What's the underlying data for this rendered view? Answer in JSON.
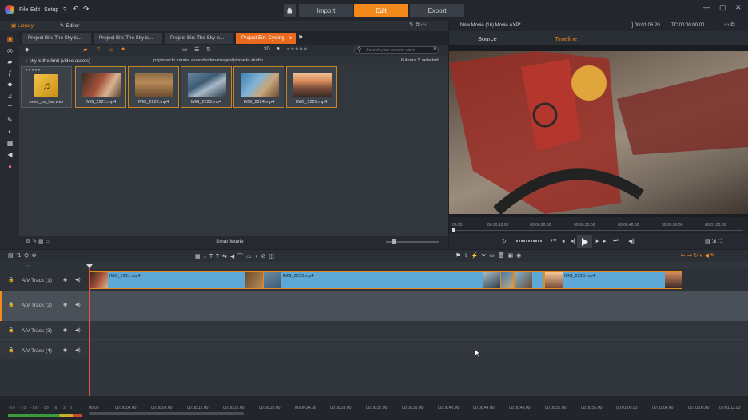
{
  "menu": {
    "file": "File",
    "edit": "Edit",
    "setup": "Setup",
    "help": "?",
    "undo": "↶",
    "redo": "↷"
  },
  "modes": {
    "import": "Import",
    "edit": "Edit",
    "export": "Export"
  },
  "library": {
    "library_tab": "Library",
    "editor_tab": "Editor"
  },
  "bin_tabs": [
    "Project Bin: The Sky is...",
    "Project Bin: The Sky is...",
    "Project Bin: The Sky is...",
    "Project Bin: Cycling"
  ],
  "bin_close": "×",
  "toolbar": {
    "threed": "3D",
    "stars": "★★★★★",
    "search_placeholder": "Search your current view"
  },
  "path": {
    "folder": "sky is the limit (video assets)",
    "location": "p:\\pinnacle tutorial assets\\video-images\\pinnacle studio",
    "status": "6 items, 5 selected"
  },
  "assets": [
    {
      "label": "bmix_ps_hal.wav",
      "type": "audio"
    },
    {
      "label": "IMG_2221.mp4",
      "type": "video"
    },
    {
      "label": "IMG_2222.mp4",
      "type": "video"
    },
    {
      "label": "IMG_2223.mp4",
      "type": "video"
    },
    {
      "label": "IMG_2224.mp4",
      "type": "video"
    },
    {
      "label": "IMG_2225.mp4",
      "type": "video"
    }
  ],
  "smartmovie": "SmartMovie",
  "player": {
    "title": "New Movie (16).Movie.AXP*",
    "timecode": "[] 00:01:06.20",
    "tc2": "TC 00:00:00.00",
    "source_tab": "Source",
    "timeline_tab": "Timeline"
  },
  "player_ruler": [
    "00:00",
    "00:00:10.00",
    "00:00:20.00",
    "00:00:30.00",
    "00:00:40.00",
    "00:00:50.00",
    "00:01:00.00"
  ],
  "tracks": [
    {
      "name": "A/V Track (1)"
    },
    {
      "name": "A/V Track (2)"
    },
    {
      "name": "A/V Track (3)"
    },
    {
      "name": "A/V Track (4)"
    }
  ],
  "clips": [
    {
      "label": "IMG_2221.mp4"
    },
    {
      "label": "IMG_2223.mp4"
    },
    {
      "label": "IMG_2225.mp4"
    }
  ],
  "timeline_ruler": [
    "00:00",
    "00:00:04.00",
    "00:00:08.00",
    "00:00:12.00",
    "00:00:16.00",
    "00:00:20.00",
    "00:00:24.00",
    "00:00:28.00",
    "00:00:32.00",
    "00:00:36.00",
    "00:00:40.00",
    "00:00:44.00",
    "00:00:48.00",
    "00:00:52.00",
    "00:00:56.00",
    "00:01:00.00",
    "00:01:04.00",
    "00:01:08.00",
    "00:01:12.00"
  ],
  "meter_labels": [
    "-60",
    "-22",
    "-16",
    "-10",
    "-6",
    "-3",
    "0"
  ],
  "colors": {
    "accent": "#f28a1c",
    "clip": "#5ea8d8",
    "clip_border": "#e68b1d"
  }
}
